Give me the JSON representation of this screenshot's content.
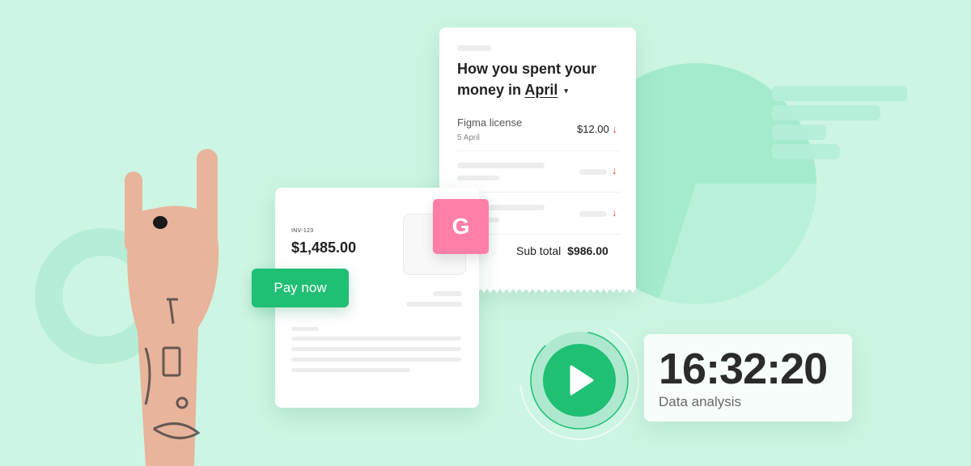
{
  "colors": {
    "background": "#cdf5e3",
    "accent_green": "#1fbf74",
    "badge_pink": "#ff7fa7",
    "arrow_red": "#e0463c"
  },
  "receipt": {
    "title_line1": "How you spent your",
    "title_line2_prefix": "money in",
    "month": "April",
    "caret_icon": "▾",
    "items": [
      {
        "name": "Figma license",
        "date": "5 April",
        "amount": "$12.00",
        "trend_icon": "↓"
      },
      {
        "name": "",
        "date": "",
        "amount": "",
        "trend_icon": "↓"
      },
      {
        "name": "",
        "date": "",
        "amount": "",
        "trend_icon": "↓"
      }
    ],
    "subtotal_label": "Sub total",
    "subtotal_value": "$986.00"
  },
  "invoice": {
    "number": "INV-123",
    "amount": "$1,485.00",
    "pay_button": "Pay now",
    "badge_letter": "G"
  },
  "timer": {
    "time": "16:32:20",
    "label": "Data analysis",
    "play_icon": "play-icon"
  }
}
